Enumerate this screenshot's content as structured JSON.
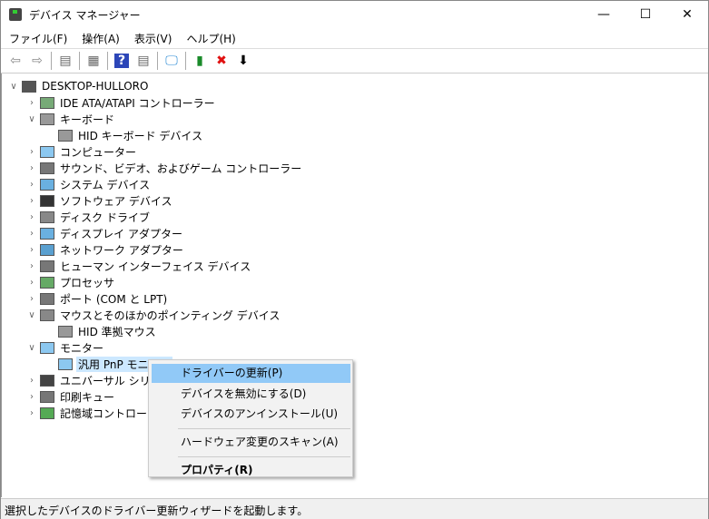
{
  "window": {
    "title": "デバイス マネージャー",
    "minimize": "—",
    "maximize": "☐",
    "close": "✕"
  },
  "menu": [
    "ファイル(F)",
    "操作(A)",
    "表示(V)",
    "ヘルプ(H)"
  ],
  "toolbar": [
    {
      "icon": "back-icon",
      "glyph": "⇦",
      "color": "#888"
    },
    {
      "icon": "forward-icon",
      "glyph": "⇨",
      "color": "#888"
    },
    {
      "sep": true
    },
    {
      "icon": "console-tree-icon",
      "glyph": "▤",
      "color": "#666"
    },
    {
      "sep": true
    },
    {
      "icon": "properties-icon",
      "glyph": "▦",
      "color": "#666"
    },
    {
      "sep": true
    },
    {
      "icon": "help-icon",
      "glyph": "?",
      "color": "#fff",
      "bg": "#2c46b8"
    },
    {
      "icon": "action-pane-icon",
      "glyph": "▤",
      "color": "#666"
    },
    {
      "sep": true
    },
    {
      "icon": "scan-hardware-icon",
      "glyph": "🖵",
      "color": "#2a8ad4"
    },
    {
      "sep": true
    },
    {
      "icon": "update-driver-icon",
      "glyph": "▮",
      "color": "#1a8a2a"
    },
    {
      "icon": "uninstall-icon",
      "glyph": "✖",
      "color": "#e01010"
    },
    {
      "icon": "download-icon",
      "glyph": "⬇",
      "color": "#000"
    }
  ],
  "tree": [
    {
      "label": "DESKTOP-HULLORO",
      "level": 0,
      "exp": "∨"
    },
    {
      "label": "IDE ATA/ATAPI コントローラー",
      "level": 1,
      "exp": "›"
    },
    {
      "label": "キーボード",
      "level": 1,
      "exp": "∨"
    },
    {
      "label": "HID キーボード デバイス",
      "level": 2,
      "exp": ""
    },
    {
      "label": "コンピューター",
      "level": 1,
      "exp": "›"
    },
    {
      "label": "サウンド、ビデオ、およびゲーム コントローラー",
      "level": 1,
      "exp": "›"
    },
    {
      "label": "システム デバイス",
      "level": 1,
      "exp": "›"
    },
    {
      "label": "ソフトウェア デバイス",
      "level": 1,
      "exp": "›"
    },
    {
      "label": "ディスク ドライブ",
      "level": 1,
      "exp": "›"
    },
    {
      "label": "ディスプレイ アダプター",
      "level": 1,
      "exp": "›"
    },
    {
      "label": "ネットワーク アダプター",
      "level": 1,
      "exp": "›"
    },
    {
      "label": "ヒューマン インターフェイス デバイス",
      "level": 1,
      "exp": "›"
    },
    {
      "label": "プロセッサ",
      "level": 1,
      "exp": "›"
    },
    {
      "label": "ポート (COM と LPT)",
      "level": 1,
      "exp": "›"
    },
    {
      "label": "マウスとそのほかのポインティング デバイス",
      "level": 1,
      "exp": "∨"
    },
    {
      "label": "HID 準拠マウス",
      "level": 2,
      "exp": ""
    },
    {
      "label": "モニター",
      "level": 1,
      "exp": "∨"
    },
    {
      "label": "汎用 PnP モニター",
      "level": 2,
      "exp": "",
      "selected": true
    },
    {
      "label": "ユニバーサル シリアル バス コントローラー",
      "level": 1,
      "exp": "›"
    },
    {
      "label": "印刷キュー",
      "level": 1,
      "exp": "›"
    },
    {
      "label": "記憶域コントローラー",
      "level": 1,
      "exp": "›"
    }
  ],
  "context_menu": [
    {
      "label": "ドライバーの更新(P)",
      "highlighted": true
    },
    {
      "label": "デバイスを無効にする(D)"
    },
    {
      "label": "デバイスのアンインストール(U)"
    },
    {
      "sep": true
    },
    {
      "label": "ハードウェア変更のスキャン(A)"
    },
    {
      "sep": true
    },
    {
      "label": "プロパティ(R)",
      "bold": true
    }
  ],
  "status": "選択したデバイスのドライバー更新ウィザードを起動します。"
}
